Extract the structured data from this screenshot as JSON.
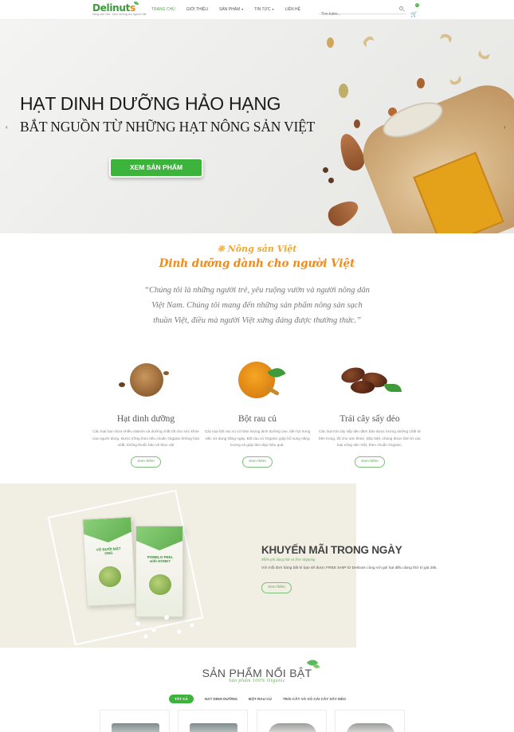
{
  "header": {
    "logo_text_a": "Delinut",
    "logo_text_b": "s",
    "logo_tagline": "Nông sản Việt · Dinh dưỡng cho người Việt",
    "nav": [
      {
        "label": "TRANG CHỦ",
        "active": true,
        "has_caret": false
      },
      {
        "label": "GIỚI THIỆU",
        "active": false,
        "has_caret": false
      },
      {
        "label": "SẢN PHẨM",
        "active": false,
        "has_caret": true
      },
      {
        "label": "TIN TỨC",
        "active": false,
        "has_caret": true
      },
      {
        "label": "LIÊN HỆ",
        "active": false,
        "has_caret": false
      }
    ],
    "search_placeholder": "Tìm kiếm...",
    "cart_count": "0"
  },
  "hero": {
    "title": "HẠT DINH DƯỠNG HẢO HẠNG",
    "subtitle": "BẮT NGUỒN TỪ NHỮNG HẠT NÔNG SẢN VIỆT",
    "button": "XEM SẢN PHẨM",
    "prev": "‹",
    "next": "›"
  },
  "intro": {
    "script_line1": "❊ Nông sản Việt",
    "script_line2": "Dinh dưỡng dành cho người Việt",
    "quote": "“Chúng tôi là những người trẻ, yêu ruộng vườn và người nông dân Việt Nam. Chúng tôi mang đến những sản phẩm nông sản sạch thuần Việt, điều mà người Việt xứng đáng được thưởng thức.”"
  },
  "features": [
    {
      "title": "Hạt dinh dưỡng",
      "desc": "Các loại hạt chứa nhiều vitamin và dưỡng chất tốt cho sức khỏe của người dùng. Được trồng theo tiêu chuẩn Organic không hóa chất, không thuốc bảo vệ thực vật",
      "button": "Xem thêm"
    },
    {
      "title": "Bột rau củ",
      "desc": "Các loại bột rau củ có hàm lượng dinh dưỡng cao, tiện lợi trong việc sử dụng hằng ngày. Bột rau củ Organic giúp bổ sung năng lượng và giúp làm đẹp hiệu quả.",
      "button": "Xem thêm"
    },
    {
      "title": "Trái cây sấy dẻo",
      "desc": "Các loại trái cây sấy dẻo đảm bảo được lượng dưỡng chất từ bên trong, tốt cho sức khỏe. Đặc biệt, chúng được làm từ các loại nông sản Việt, theo chuẩn Organic.",
      "button": "Xem thêm"
    }
  ],
  "promo": {
    "title": "KHUYẾN MÃI TRONG NGÀY",
    "script": "Miễn phí dùng thử và free shipping",
    "desc": "Với mỗi đơn hàng bất kì bạn sẽ được FREE SHIP từ Delinuts cùng với gói hạt điều dùng thử trị giá 25k.",
    "button": "Xem thêm",
    "bag1_label": "VỎ BƯỞI MẬT ONG",
    "bag2_label": "POMELO PEEL with HONEY"
  },
  "featured": {
    "title": "SẢN PHẨM NỔI BẬT",
    "subtitle": "Sản phẩm 100% Organic",
    "tabs": [
      {
        "label": "TẤT CẢ",
        "active": true
      },
      {
        "label": "HẠT DINH DƯỠNG",
        "active": false
      },
      {
        "label": "BỘT RAU CỦ",
        "active": false
      },
      {
        "label": "TRÁI CÂY VÀ VỎ CÁI CÂY SẤY DẺO",
        "active": false
      }
    ]
  },
  "colors": {
    "accent_green": "#3cb43c",
    "script_orange": "#ef8a1b",
    "promo_bg": "#f1eee3"
  }
}
